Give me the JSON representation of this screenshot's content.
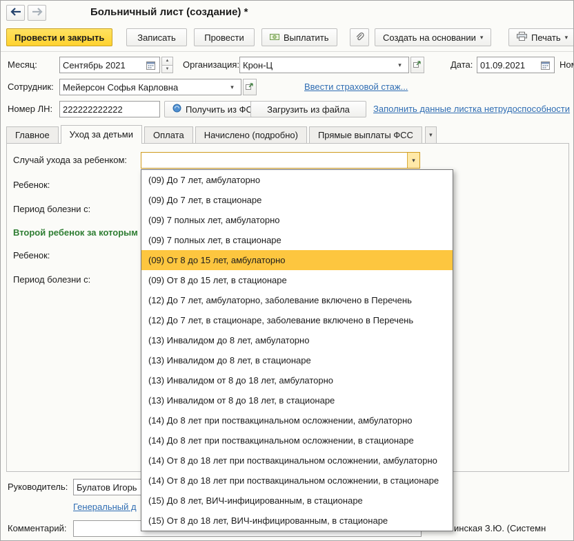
{
  "window": {
    "title": "Больничный лист (создание) *"
  },
  "toolbar": {
    "post_and_close": "Провести и закрыть",
    "save": "Записать",
    "post": "Провести",
    "pay": "Выплатить",
    "create_based_on": "Создать на основании",
    "print": "Печать"
  },
  "header_fields": {
    "month_label": "Месяц:",
    "month_value": "Сентябрь 2021",
    "organization_label": "Организация:",
    "organization_value": "Крон-Ц",
    "date_label": "Дата:",
    "date_value": "01.09.2021",
    "number_label_cut": "Ном",
    "employee_label": "Сотрудник:",
    "employee_value": "Мейерсон Софья Карловна",
    "insurance_record_link": "Ввести страховой стаж...",
    "ln_number_label": "Номер ЛН:",
    "ln_number_value": "222222222222",
    "get_from_fss": "Получить из ФСС",
    "load_from_file": "Загрузить из файла",
    "fill_data_link": "Заполнить данные листка нетрудоспособности"
  },
  "tabs": [
    {
      "label": "Главное",
      "active": false
    },
    {
      "label": "Уход за детьми",
      "active": true
    },
    {
      "label": "Оплата",
      "active": false
    },
    {
      "label": "Начислено (подробно)",
      "active": false
    },
    {
      "label": "Прямые выплаты ФСС",
      "active": false
    }
  ],
  "care_tab": {
    "case_label": "Случай ухода за ребенком:",
    "case_value": "",
    "child_label": "Ребенок:",
    "period_label": "Период болезни с:",
    "second_child_header": "Второй ребенок за которым с",
    "child2_label": "Ребенок:",
    "period2_label": "Период болезни с:"
  },
  "dropdown": {
    "items": [
      {
        "label": "(09) До 7 лет, амбулаторно",
        "highlighted": false
      },
      {
        "label": "(09) До 7 лет, в стационаре",
        "highlighted": false
      },
      {
        "label": "(09) 7 полных лет, амбулаторно",
        "highlighted": false
      },
      {
        "label": "(09) 7 полных лет, в стационаре",
        "highlighted": false
      },
      {
        "label": "(09) От 8 до 15 лет, амбулаторно",
        "highlighted": true
      },
      {
        "label": "(09) От 8 до 15 лет, в стационаре",
        "highlighted": false
      },
      {
        "label": "(12) До 7 лет, амбулаторно, заболевание включено в Перечень",
        "highlighted": false
      },
      {
        "label": "(12) До 7 лет, в стационаре, заболевание включено в Перечень",
        "highlighted": false
      },
      {
        "label": "(13) Инвалидом до 8 лет, амбулаторно",
        "highlighted": false
      },
      {
        "label": "(13) Инвалидом до 8 лет, в стационаре",
        "highlighted": false
      },
      {
        "label": "(13) Инвалидом от 8 до 18 лет, амбулаторно",
        "highlighted": false
      },
      {
        "label": "(13) Инвалидом от 8 до 18 лет, в стационаре",
        "highlighted": false
      },
      {
        "label": "(14) До 8 лет при поствакцинальном осложнении, амбулаторно",
        "highlighted": false
      },
      {
        "label": "(14) До 8 лет при поствакцинальном осложнении, в стационаре",
        "highlighted": false
      },
      {
        "label": "(14) От 8 до 18 лет при поствакцинальном осложнении, амбулаторно",
        "highlighted": false
      },
      {
        "label": "(14) От 8 до 18 лет при поствакцинальном осложнении, в стационаре",
        "highlighted": false
      },
      {
        "label": "(15) До 8 лет, ВИЧ-инфицированным, в стационаре",
        "highlighted": false
      },
      {
        "label": "(15) От 8 до 18 лет, ВИЧ-инфицированным, в стационаре",
        "highlighted": false
      }
    ]
  },
  "footer": {
    "manager_label": "Руководитель:",
    "manager_value": "Булатов Игорь",
    "position_link": "Генеральный д",
    "comment_label": "Комментарий:",
    "comment_value": "",
    "responsible_partial": "инская З.Ю. (Системн"
  },
  "icons": {
    "dropdown_arrow": "▾",
    "spin_up": "▲",
    "spin_down": "▼"
  },
  "colors": {
    "accent_yellow": "#FFD22E",
    "list_highlight": "#FDC63F",
    "link_blue": "#2F6DB3",
    "group_green": "#2E7D32"
  }
}
